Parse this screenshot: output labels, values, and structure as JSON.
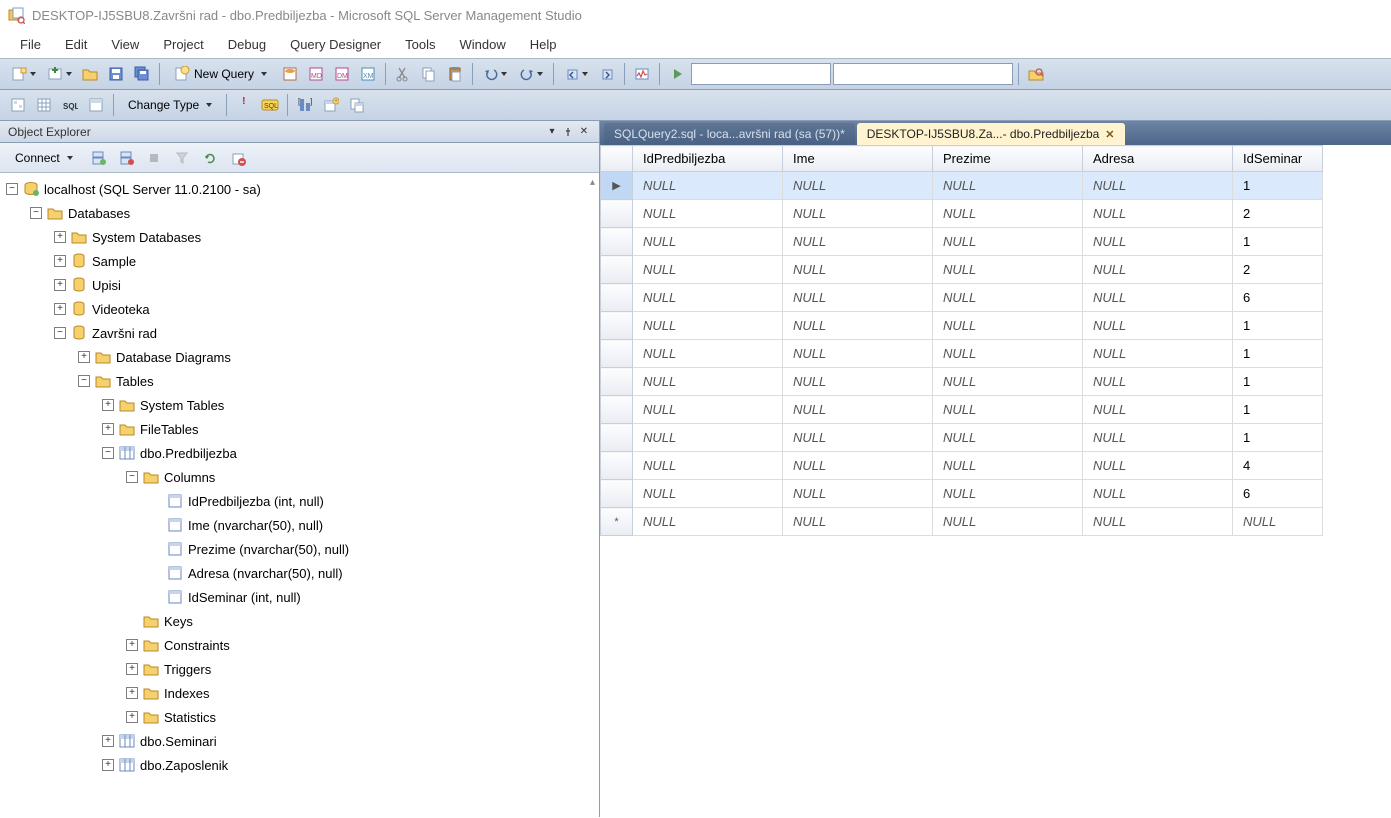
{
  "window_title": "DESKTOP-IJ5SBU8.Završni rad - dbo.Predbiljezba - Microsoft SQL Server Management Studio",
  "menubar": [
    "File",
    "Edit",
    "View",
    "Project",
    "Debug",
    "Query Designer",
    "Tools",
    "Window",
    "Help"
  ],
  "toolbar1": {
    "new_query": "New Query"
  },
  "toolbar2": {
    "change_type": "Change Type"
  },
  "object_explorer": {
    "title": "Object Explorer",
    "connect": "Connect"
  },
  "tree": {
    "server": "localhost (SQL Server 11.0.2100 - sa)",
    "databases": "Databases",
    "system_databases": "System Databases",
    "db1": "Sample",
    "db2": "Upisi",
    "db3": "Videoteka",
    "db4": "Završni rad",
    "diagrams": "Database Diagrams",
    "tables": "Tables",
    "system_tables": "System Tables",
    "file_tables": "FileTables",
    "table1": "dbo.Predbiljezba",
    "columns": "Columns",
    "col1": "IdPredbiljezba (int, null)",
    "col2": "Ime (nvarchar(50), null)",
    "col3": "Prezime (nvarchar(50), null)",
    "col4": "Adresa (nvarchar(50), null)",
    "col5": "IdSeminar (int, null)",
    "keys": "Keys",
    "constraints": "Constraints",
    "triggers": "Triggers",
    "indexes": "Indexes",
    "statistics": "Statistics",
    "table2": "dbo.Seminari",
    "table3": "dbo.Zaposlenik"
  },
  "tabs": {
    "tab1": "SQLQuery2.sql - loca...avršni rad (sa (57))*",
    "tab2": "DESKTOP-IJ5SBU8.Za...- dbo.Predbiljezba"
  },
  "grid": {
    "null_text": "NULL",
    "headers": [
      "IdPredbiljezba",
      "Ime",
      "Prezime",
      "Adresa",
      "IdSeminar"
    ],
    "rows": [
      {
        "selected": true,
        "marker": "▶",
        "cells": [
          "NULL",
          "NULL",
          "NULL",
          "NULL",
          "1"
        ]
      },
      {
        "selected": false,
        "marker": "",
        "cells": [
          "NULL",
          "NULL",
          "NULL",
          "NULL",
          "2"
        ]
      },
      {
        "selected": false,
        "marker": "",
        "cells": [
          "NULL",
          "NULL",
          "NULL",
          "NULL",
          "1"
        ]
      },
      {
        "selected": false,
        "marker": "",
        "cells": [
          "NULL",
          "NULL",
          "NULL",
          "NULL",
          "2"
        ]
      },
      {
        "selected": false,
        "marker": "",
        "cells": [
          "NULL",
          "NULL",
          "NULL",
          "NULL",
          "6"
        ]
      },
      {
        "selected": false,
        "marker": "",
        "cells": [
          "NULL",
          "NULL",
          "NULL",
          "NULL",
          "1"
        ]
      },
      {
        "selected": false,
        "marker": "",
        "cells": [
          "NULL",
          "NULL",
          "NULL",
          "NULL",
          "1"
        ]
      },
      {
        "selected": false,
        "marker": "",
        "cells": [
          "NULL",
          "NULL",
          "NULL",
          "NULL",
          "1"
        ]
      },
      {
        "selected": false,
        "marker": "",
        "cells": [
          "NULL",
          "NULL",
          "NULL",
          "NULL",
          "1"
        ]
      },
      {
        "selected": false,
        "marker": "",
        "cells": [
          "NULL",
          "NULL",
          "NULL",
          "NULL",
          "1"
        ]
      },
      {
        "selected": false,
        "marker": "",
        "cells": [
          "NULL",
          "NULL",
          "NULL",
          "NULL",
          "4"
        ]
      },
      {
        "selected": false,
        "marker": "",
        "cells": [
          "NULL",
          "NULL",
          "NULL",
          "NULL",
          "6"
        ]
      },
      {
        "selected": false,
        "marker": "*",
        "cells": [
          "NULL",
          "NULL",
          "NULL",
          "NULL",
          "NULL"
        ]
      }
    ]
  }
}
